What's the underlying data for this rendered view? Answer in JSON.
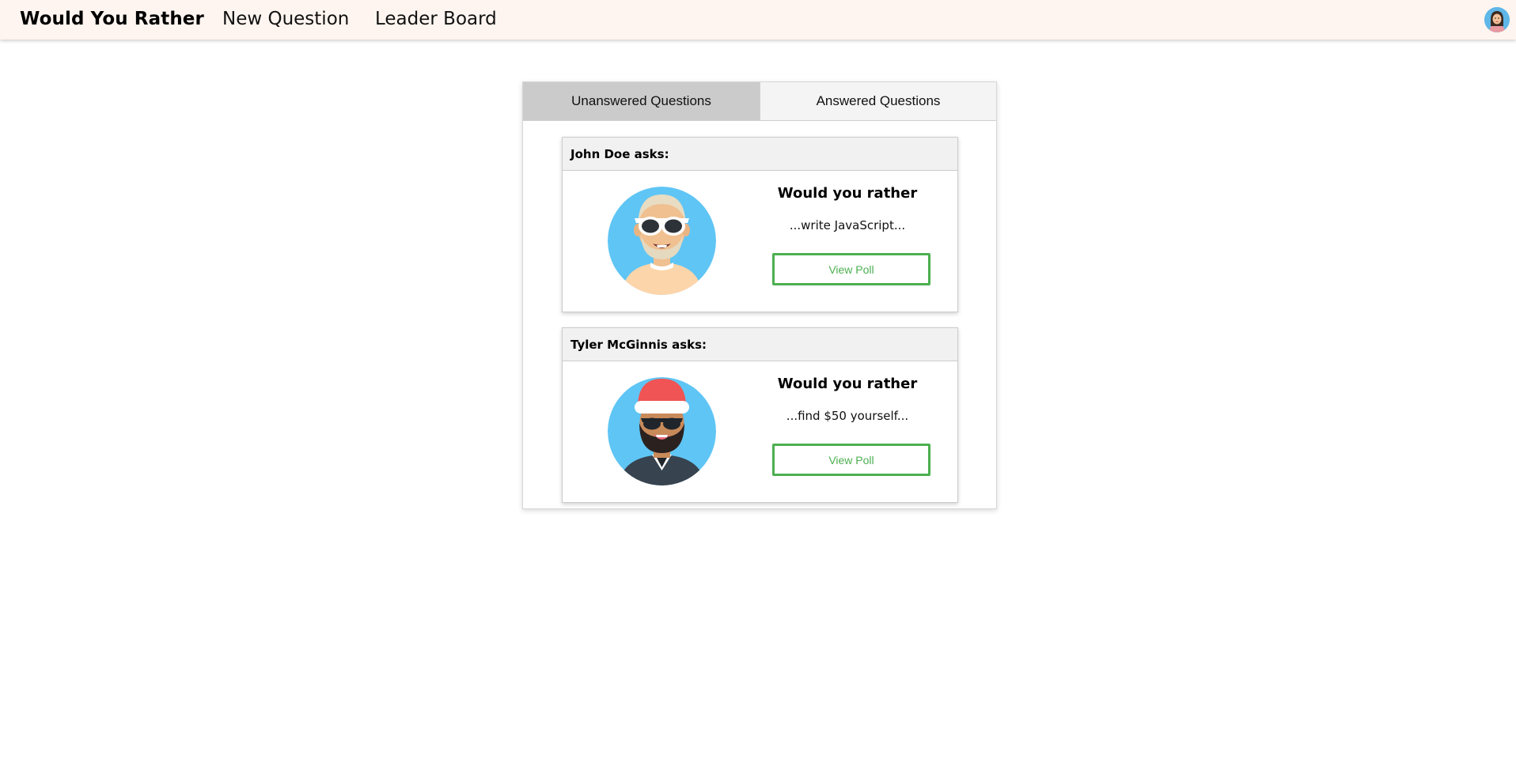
{
  "nav": {
    "brand": "Would You Rather",
    "links": [
      "New Question",
      "Leader Board"
    ],
    "avatar_icon": "user-avatar-icon"
  },
  "tabs": [
    {
      "label": "Unanswered Questions",
      "active": true
    },
    {
      "label": "Answered Questions",
      "active": false
    }
  ],
  "questions": [
    {
      "author_header": "John Doe asks:",
      "title": "Would you rather",
      "option_preview": "...write JavaScript...",
      "button_label": "View Poll",
      "avatar_icon": "bald-man-sunglasses-avatar-icon"
    },
    {
      "author_header": "Tyler McGinnis asks:",
      "title": "Would you rather",
      "option_preview": "...find $50 yourself...",
      "button_label": "View Poll",
      "avatar_icon": "santa-hat-man-avatar-icon"
    }
  ],
  "colors": {
    "navbar_bg": "#fff5f0",
    "accent_green": "#4caf50",
    "avatar_bg": "#5fc5f5",
    "active_tab": "#cbcbcb"
  }
}
